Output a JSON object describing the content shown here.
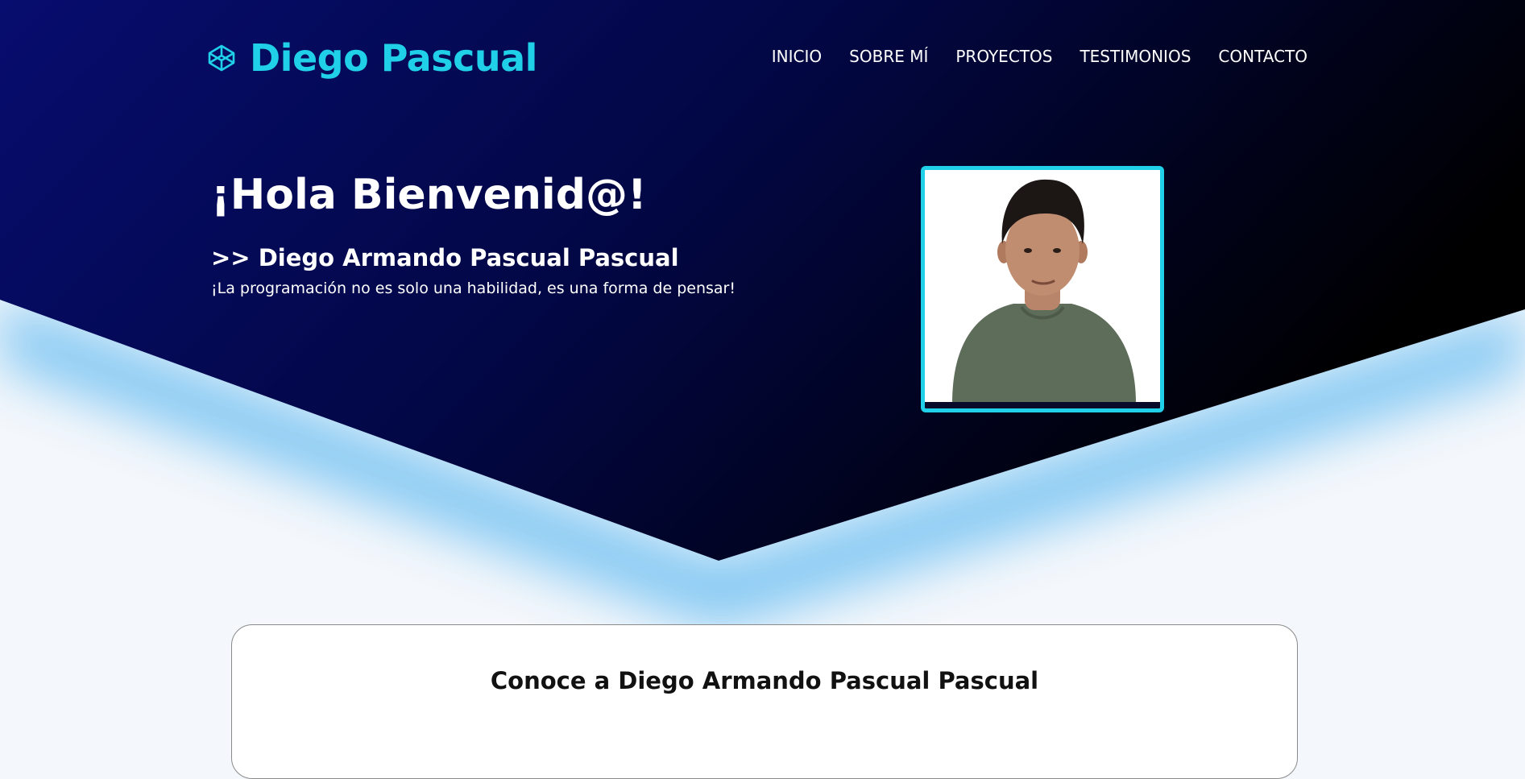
{
  "brand": {
    "name": "Diego Pascual",
    "logo_icon": "codepen-cube-icon"
  },
  "nav": {
    "items": [
      "INICIO",
      "SOBRE MÍ",
      "PROYECTOS",
      "TESTIMONIOS",
      "CONTACTO"
    ]
  },
  "hero": {
    "title": "¡Hola Bienvenid@!",
    "subtitle": ">> Diego Armando Pascual Pascual",
    "tagline": "¡La programación no es solo una habilidad, es una forma de pensar!"
  },
  "about": {
    "title": "Conoce a Diego Armando Pascual Pascual"
  },
  "colors": {
    "accent": "#1fd0e8",
    "hero_start": "#070d6e",
    "hero_end": "#000000",
    "glow": "#6fc0f2",
    "page_bg": "#f4f7fb"
  }
}
